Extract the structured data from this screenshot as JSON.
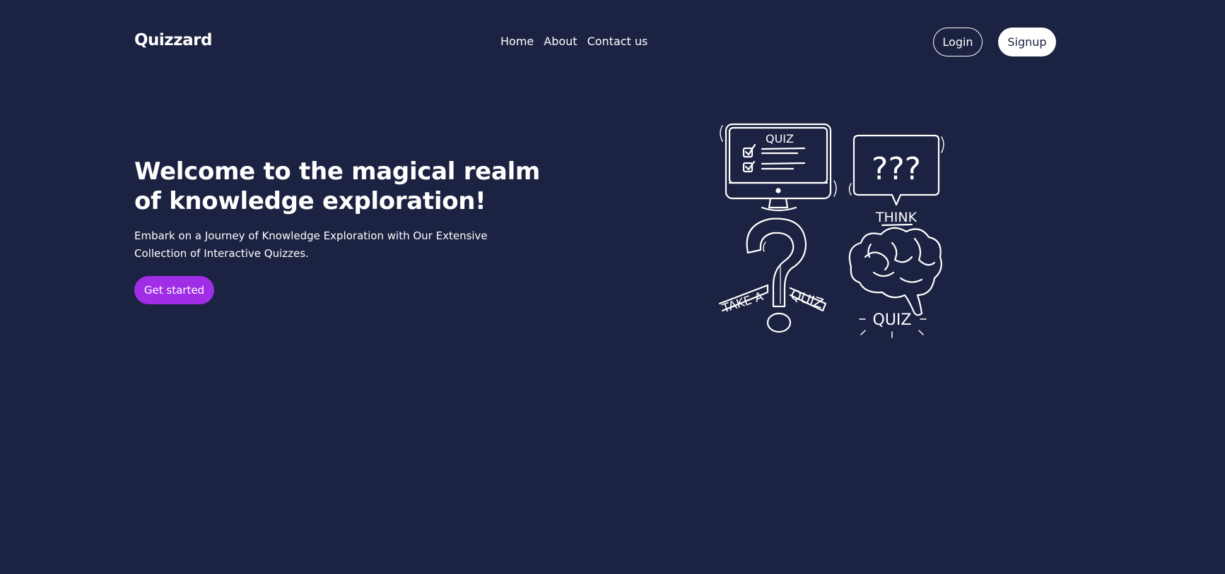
{
  "brand": "Quizzard",
  "nav": {
    "links": [
      "Home",
      "About",
      "Contact us"
    ],
    "login": "Login",
    "signup": "Signup"
  },
  "hero": {
    "title": "Welcome to the magical realm of knowledge exploration!",
    "subtitle": "Embark on a Journey of Knowledge Exploration with Our Extensive Collection of Interactive Quizzes.",
    "cta": "Get started"
  },
  "illustration": {
    "monitor_label": "QUIZ",
    "bubble_text": "???",
    "think_label": "THINK",
    "take_a_label": "TAKE A",
    "quiz_label": "QUIZ",
    "brain_label": "QUIZ"
  },
  "colors": {
    "background": "#1c2241",
    "accent": "#a02ee6",
    "text": "#ffffff"
  }
}
